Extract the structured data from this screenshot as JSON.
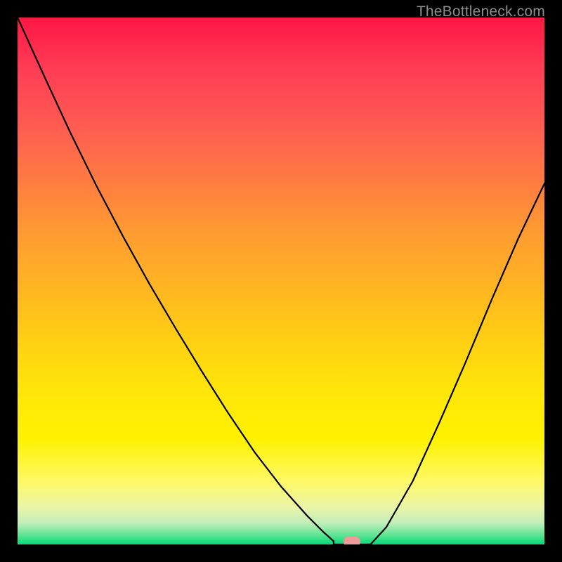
{
  "watermark": "TheBottleneck.com",
  "chart_data": {
    "type": "line",
    "title": "",
    "xlabel": "",
    "ylabel": "",
    "xlim_norm": [
      0,
      1
    ],
    "ylim_norm": [
      0,
      1
    ],
    "optimal_x_norm": 0.635,
    "flat_halfwidth_norm": 0.035,
    "curve_points_norm": [
      {
        "x": 0.0,
        "y": 0.0
      },
      {
        "x": 0.05,
        "y": 0.11
      },
      {
        "x": 0.1,
        "y": 0.218
      },
      {
        "x": 0.15,
        "y": 0.32
      },
      {
        "x": 0.2,
        "y": 0.415
      },
      {
        "x": 0.25,
        "y": 0.505
      },
      {
        "x": 0.3,
        "y": 0.59
      },
      {
        "x": 0.35,
        "y": 0.672
      },
      {
        "x": 0.4,
        "y": 0.751
      },
      {
        "x": 0.45,
        "y": 0.825
      },
      {
        "x": 0.5,
        "y": 0.89
      },
      {
        "x": 0.55,
        "y": 0.946
      },
      {
        "x": 0.58,
        "y": 0.976
      },
      {
        "x": 0.6,
        "y": 0.994
      },
      {
        "x": 0.6,
        "y": 1.0
      },
      {
        "x": 0.67,
        "y": 1.0
      },
      {
        "x": 0.7,
        "y": 0.967
      },
      {
        "x": 0.75,
        "y": 0.88
      },
      {
        "x": 0.8,
        "y": 0.77
      },
      {
        "x": 0.85,
        "y": 0.655
      },
      {
        "x": 0.9,
        "y": 0.535
      },
      {
        "x": 0.95,
        "y": 0.42
      },
      {
        "x": 1.0,
        "y": 0.315
      }
    ],
    "marker_color": "#ef9a9a",
    "gradient_stops": [
      {
        "pos": 0.0,
        "color": "#ff1744"
      },
      {
        "pos": 0.5,
        "color": "#ffcc15"
      },
      {
        "pos": 0.8,
        "color": "#fff200"
      },
      {
        "pos": 1.0,
        "color": "#00d97a"
      }
    ],
    "note": "y=0 is top (red / high bottleneck), y=1 is bottom (green / optimal). x is the swept component ratio; the dip bottom is the recommended balance point."
  }
}
